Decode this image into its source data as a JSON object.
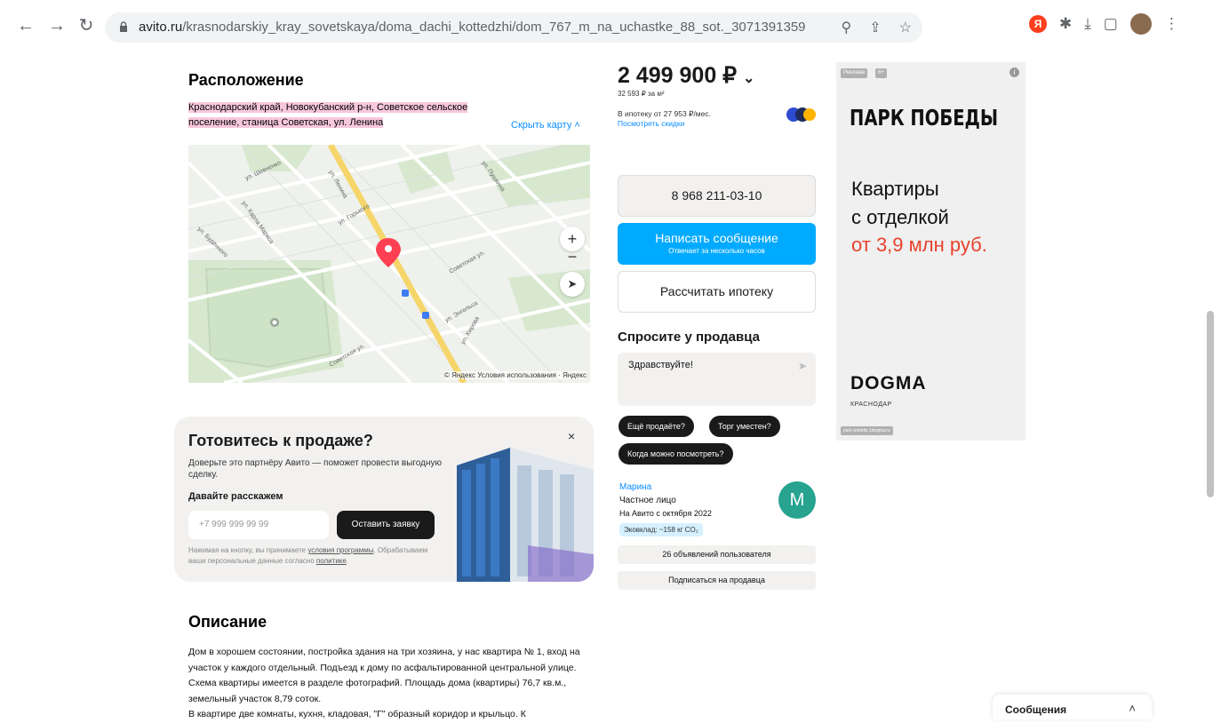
{
  "browser": {
    "url_host": "avito.ru",
    "url_path": "/krasnodarskiy_kray_sovetskaya/doma_dachi_kottedzhi/dom_767_m_na_uchastke_88_sot._3071391359"
  },
  "location": {
    "title": "Расположение",
    "address": "Краснодарский край, Новокубанский р-н, Советское сельское поселение, станица Советская, ул. Ленина",
    "hide_map": "Скрыть карту ˄",
    "map_copyright": "© Яндекс Условия использования · Яндекс",
    "zoom_in": "+",
    "zoom_out": "−",
    "map_labels": {
      "street_lenina": "ул. Ленина",
      "street_sovetskaya": "Советская ул.",
      "street_kirova": "ул. Кирова",
      "street_gorkogo": "ул. Горького",
      "street_pushkina": "ул. Пушкина",
      "street_shevchenko": "ул. Шевченко",
      "street_karla_marksa": "ул. Карла Маркса",
      "street_budenogo": "ул. Будённого",
      "street_engelsa": "ул. Энгельса"
    }
  },
  "promo": {
    "title": "Готовитесь к продаже?",
    "text": "Доверьте это партнёру Авито — поможет провести выгодную сделку.",
    "subtitle": "Давайте расскажем",
    "phone_placeholder": "+7 999 999 99 99",
    "button": "Оставить заявку",
    "legal_1": "Нажимая на кнопку, вы принимаете ",
    "legal_link_1": "условия программы",
    "legal_2": ". Обрабатываем ваши персональные данные согласно ",
    "legal_link_2": "политике",
    "legal_3": ".",
    "close": "×"
  },
  "description": {
    "title": "Описание",
    "text": "Дом в хорошем состоянии, постройка здания на три хозяина, у нас квартира № 1, вход на участок у каждого отдельный. Подъезд к дому по асфальтированной центральной улице. Схема квартиры имеется в разделе фотографий. Площадь дома (квартиры) 76,7 кв.м., земельный участок 8,79 соток.",
    "text_2": "В квартире две комнаты, кухня, кладовая, \"Г\" образный коридор и крыльцо. К"
  },
  "listing": {
    "price": "2 499 900 ₽",
    "price_chevron": "⌄",
    "price_per_m2": "32 593 ₽ за м²",
    "mortgage_line": "В ипотеку от 27 953 ₽/мес.",
    "discounts_link": "Посмотреть скидки",
    "phone_button": "8 968 211-03-10",
    "message_button": "Написать сообщение",
    "message_sub": "Отвечает за несколько часов",
    "mortgage_button": "Рассчитать ипотеку",
    "ask_title": "Спросите у продавца",
    "ask_text": "Здравствуйте!",
    "chips": [
      "Ещё продаёте?",
      "Торг уместен?",
      "Когда можно посмотреть?"
    ]
  },
  "seller": {
    "name": "Марина",
    "type": "Частное лицо",
    "since": "На Авито с октября 2022",
    "eco": "Эковклад: ~158 кг CO₂",
    "avatar_letter": "M",
    "listings_button": "26 объявлений пользователя",
    "subscribe_button": "Подписаться на продавца"
  },
  "ad": {
    "tag": "Реклама",
    "age": "6+",
    "info": "i",
    "brand": "ПАРК ПОБЕДЫ",
    "line1": "Квартиры",
    "line2": "с отделкой",
    "line3": "от 3,9 млн руб.",
    "developer": "DOGMA",
    "city": "КРАСНОДАР",
    "url": "park-pobedy.1dogma.ru"
  },
  "messages_widget": {
    "label": "Сообщения",
    "chevron": "˄"
  },
  "colors": {
    "accent_blue": "#00aaff",
    "link_blue": "#0a8dff",
    "address_highlight": "#f7c7dc",
    "avatar": "#27a38f",
    "ad_red": "#e8412c",
    "map_pin": "#ff4053"
  },
  "icons": [
    "back-icon",
    "forward-icon",
    "reload-icon",
    "lock-icon",
    "zoom-icon",
    "share-icon",
    "star-icon",
    "yandex-icon",
    "puzzle-icon",
    "download-icon",
    "sidepanel-icon",
    "menu-icon",
    "map-pin-icon",
    "locate-icon",
    "send-icon",
    "close-icon"
  ]
}
